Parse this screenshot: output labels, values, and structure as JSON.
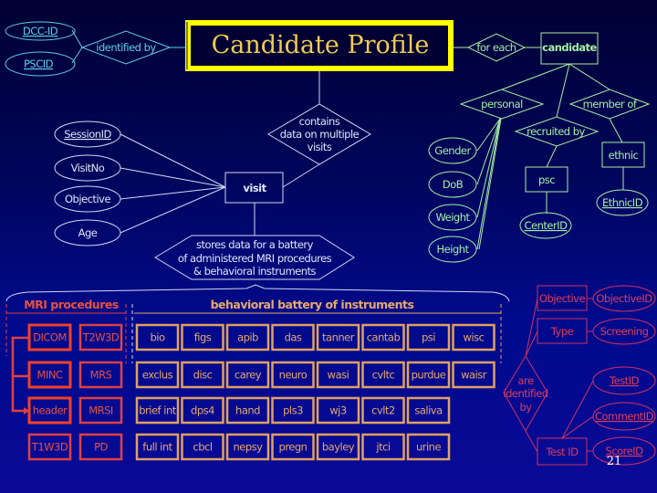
{
  "title": "Candidate Profile",
  "colors": {
    "background_top": "#000033",
    "background_bottom": "#0a0a96",
    "title_border": "#ffff00",
    "title_text": "#f0cc50",
    "candidate_attrs": "#5ecfe6",
    "visit": "#e0e6f8",
    "candidate_entity": "#a6f0a0",
    "mri": "#e85040",
    "behavioral": "#e8a86a",
    "instrument_meta": "#e03a5a"
  },
  "candidate_keys": {
    "dcc_id": "DCC-ID",
    "pscid": "PSCID",
    "identified_by": "identified by"
  },
  "candidate": {
    "for_each": "for each",
    "entity": "candidate",
    "personal": "personal",
    "member_of": "member of",
    "recruited_by": "recruited by",
    "attributes": [
      "Gender",
      "DoB",
      "Weight",
      "Height"
    ],
    "psc": "psc",
    "center_id": "CenterID",
    "ethnic": "ethnic",
    "ethnic_id": "EthnicID"
  },
  "visit": {
    "relationship": [
      "contains",
      "data on multiple",
      "visits"
    ],
    "entity": "visit",
    "attributes": [
      "SessionID",
      "VisitNo",
      "Objective",
      "Age"
    ],
    "stores": [
      "stores data for a battery",
      "of administered MRI procedures",
      "& behavioral instruments"
    ]
  },
  "mri": {
    "heading": "MRI procedures",
    "rows": [
      [
        "DICOM",
        "T2W3D"
      ],
      [
        "MINC",
        "MRS"
      ],
      [
        "header",
        "MRSI"
      ],
      [
        "T1W3D",
        "PD"
      ]
    ]
  },
  "behavioral": {
    "heading": "behavioral battery of instruments",
    "rows": [
      [
        "bio",
        "figs",
        "apib",
        "das",
        "tanner",
        "cantab",
        "psi",
        "wisc"
      ],
      [
        "exclus",
        "disc",
        "carey",
        "neuro",
        "wasi",
        "cvltc",
        "purdue",
        "waisr"
      ],
      [
        "brief int",
        "dps4",
        "hand",
        "pls3",
        "wj3",
        "cvlt2",
        "saliva"
      ],
      [
        "full int",
        "cbcl",
        "nepsy",
        "pregn",
        "bayley",
        "jtci",
        "urine"
      ]
    ]
  },
  "instrument_meta": {
    "objective": "Objective",
    "objective_id": "ObjectiveID",
    "type": "Type",
    "screening": "Screening",
    "are_identified_by": [
      "are",
      "identified",
      "by"
    ],
    "test_id_entity": "Test ID",
    "test_id": "TestID",
    "comment_id": "CommentID",
    "score_id": "ScoreID"
  },
  "page_number": "21"
}
